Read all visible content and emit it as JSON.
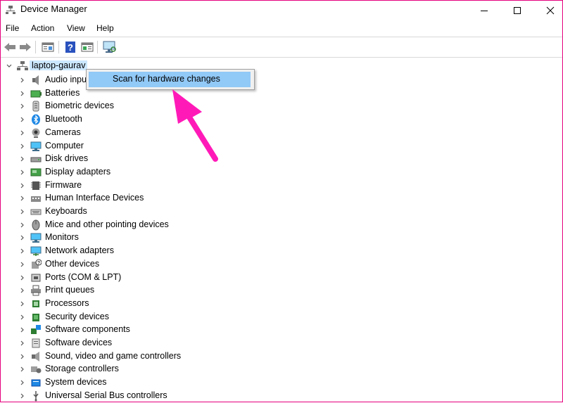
{
  "window": {
    "title": "Device Manager"
  },
  "menu": [
    "File",
    "Action",
    "View",
    "Help"
  ],
  "tree": {
    "root": "laptop-gaurav",
    "items": [
      "Audio inputs and outputs",
      "Batteries",
      "Biometric devices",
      "Bluetooth",
      "Cameras",
      "Computer",
      "Disk drives",
      "Display adapters",
      "Firmware",
      "Human Interface Devices",
      "Keyboards",
      "Mice and other pointing devices",
      "Monitors",
      "Network adapters",
      "Other devices",
      "Ports (COM & LPT)",
      "Print queues",
      "Processors",
      "Security devices",
      "Software components",
      "Software devices",
      "Sound, video and game controllers",
      "Storage controllers",
      "System devices",
      "Universal Serial Bus controllers"
    ],
    "audio_visible": "Audio inpu"
  },
  "context_menu": {
    "item": "Scan for hardware changes"
  },
  "colors": {
    "accent_highlight": "#91c9f7",
    "root_select": "#cce8ff",
    "annotation_arrow": "#ff1ab8",
    "border": "#e6007e"
  },
  "icons": [
    "computer-icon",
    "back-arrow-icon",
    "forward-arrow-icon",
    "properties-icon",
    "help-icon",
    "details-icon",
    "scan-monitor-icon"
  ]
}
